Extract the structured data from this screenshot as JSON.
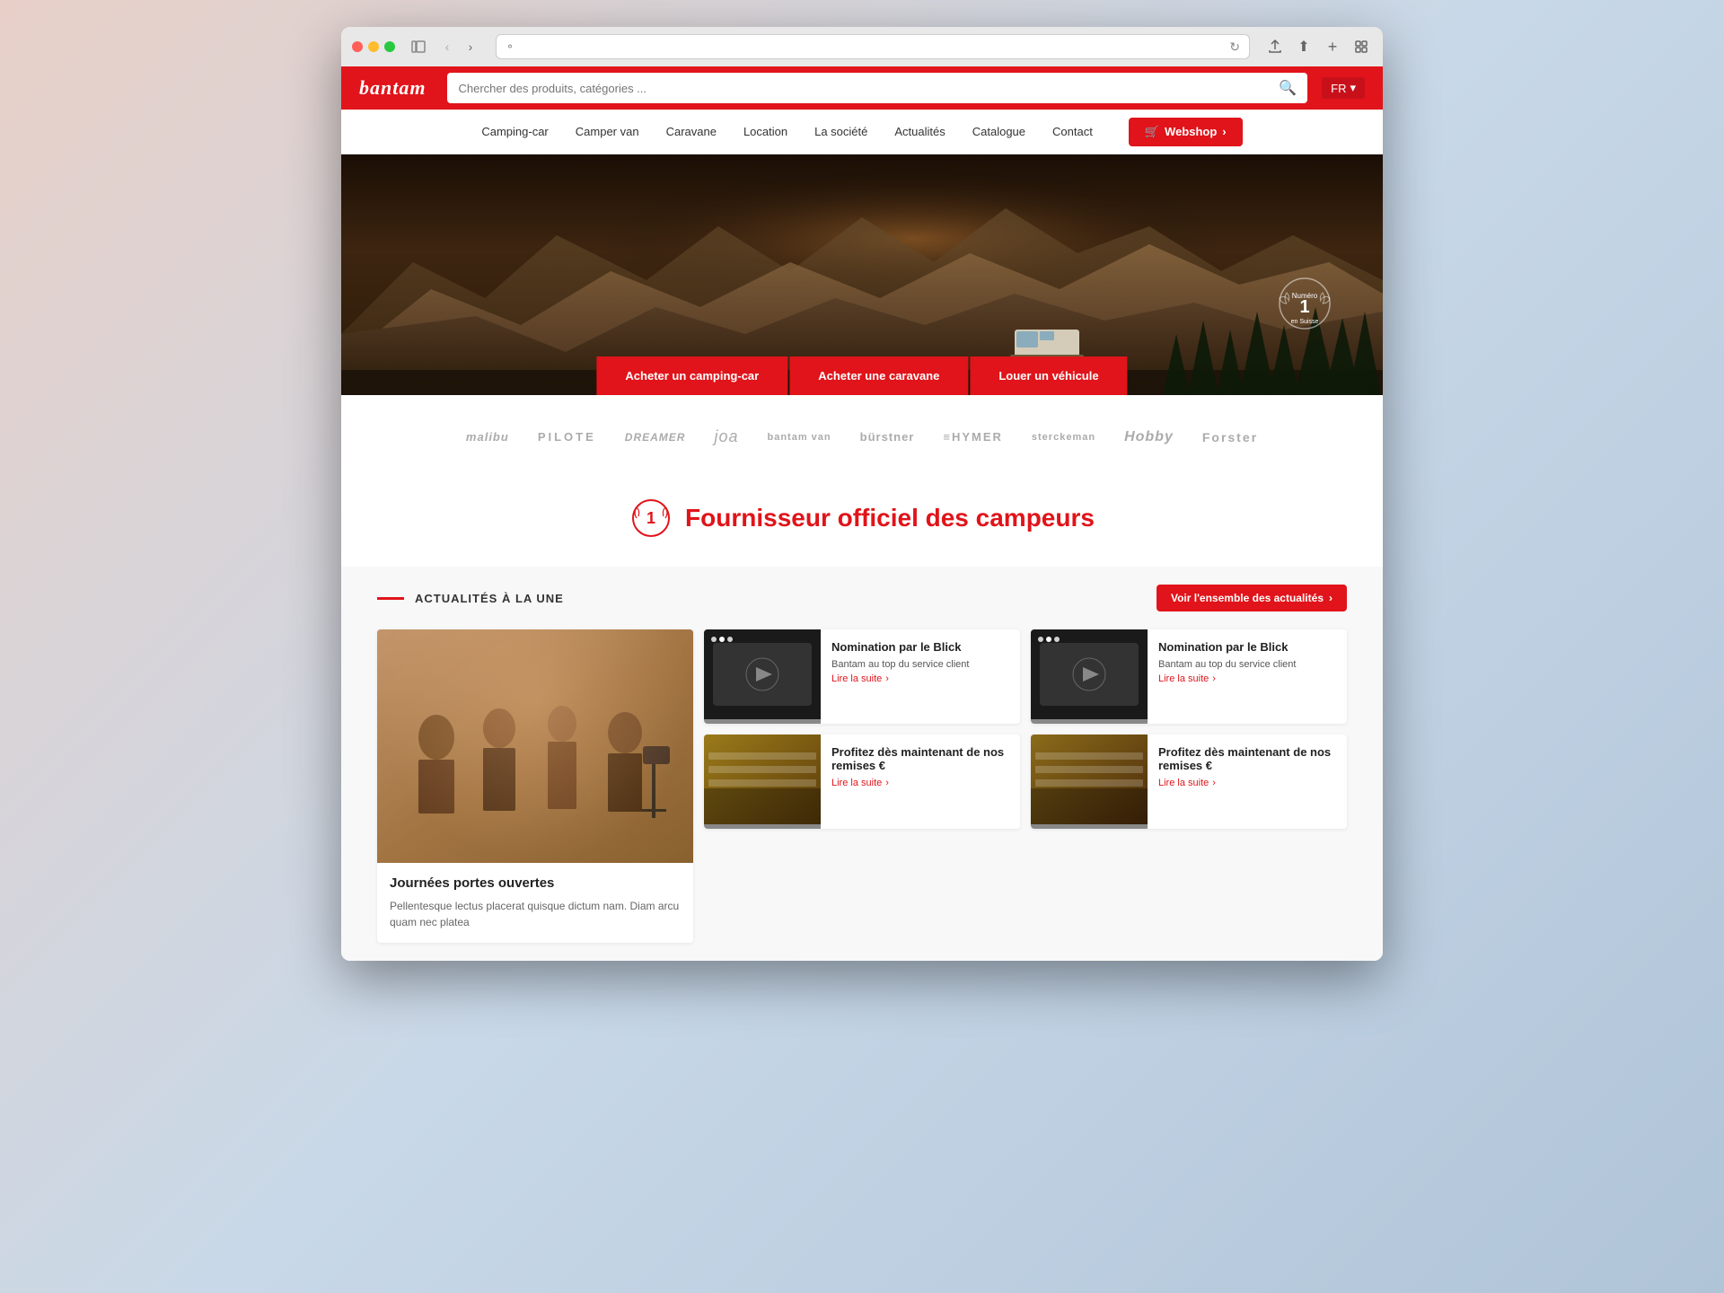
{
  "browser": {
    "url": "",
    "dots": [
      "red",
      "yellow",
      "green"
    ]
  },
  "topbar": {
    "logo": "bantam",
    "search_placeholder": "Chercher des produits, catégories ...",
    "lang": "FR"
  },
  "navbar": {
    "items": [
      {
        "label": "Camping-car",
        "id": "camping-car"
      },
      {
        "label": "Camper van",
        "id": "camper-van"
      },
      {
        "label": "Caravane",
        "id": "caravane"
      },
      {
        "label": "Location",
        "id": "location"
      },
      {
        "label": "La société",
        "id": "la-societe"
      },
      {
        "label": "Actualités",
        "id": "actualites"
      },
      {
        "label": "Catalogue",
        "id": "catalogue"
      },
      {
        "label": "Contact",
        "id": "contact"
      }
    ],
    "webshop": "Webshop"
  },
  "hero": {
    "badge_number": "1",
    "badge_subtitle": "en Suisse",
    "ctas": [
      {
        "label": "Acheter un camping-car",
        "id": "buy-camping"
      },
      {
        "label": "Acheter une caravane",
        "id": "buy-caravane"
      },
      {
        "label": "Louer un véhicule",
        "id": "rent-vehicle"
      }
    ]
  },
  "brands": {
    "items": [
      {
        "label": "malibu",
        "class": "malibu"
      },
      {
        "label": "PILOTE",
        "class": "pilote"
      },
      {
        "label": "DREAMER",
        "class": "dreamer"
      },
      {
        "label": "joa",
        "class": "joa"
      },
      {
        "label": "bantam van",
        "class": "bantam-van"
      },
      {
        "label": "bürstner",
        "class": "burstner"
      },
      {
        "label": "≡HYMER",
        "class": "hymer"
      },
      {
        "label": "sterckeman",
        "class": "sterckeman"
      },
      {
        "label": "Hobby",
        "class": "hobby"
      },
      {
        "label": "Forster",
        "class": "forster"
      }
    ]
  },
  "supplier": {
    "title": "Fournisseur officiel des campeurs",
    "badge_num": "1"
  },
  "news": {
    "section_title": "ACTUALITÉS À LA UNE",
    "see_all_btn": "Voir l'ensemble des actualités",
    "cards": [
      {
        "id": "large",
        "title": "Journées portes ouvertes",
        "text": "Pellentesque lectus placerat quisque dictum nam. Diam arcu quam nec platea"
      },
      {
        "id": "small-1",
        "title": "Nomination par le Blick",
        "subtitle": "Bantam au top du service client",
        "read_more": "Lire la suite"
      },
      {
        "id": "small-2",
        "title": "Nomination par le Blick",
        "subtitle": "Bantam au top du service client",
        "read_more": "Lire la suite"
      },
      {
        "id": "small-3",
        "title": "Profitez dès maintenant de nos remises €",
        "subtitle": "",
        "read_more": "Lire la suite"
      },
      {
        "id": "small-4",
        "title": "Profitez dès maintenant de nos remises €",
        "subtitle": "",
        "read_more": "Lire la suite"
      }
    ]
  },
  "icons": {
    "search": "🔍",
    "cart": "🛒",
    "arrow_right": "›",
    "chevron_down": "▾",
    "reload": "↻"
  }
}
